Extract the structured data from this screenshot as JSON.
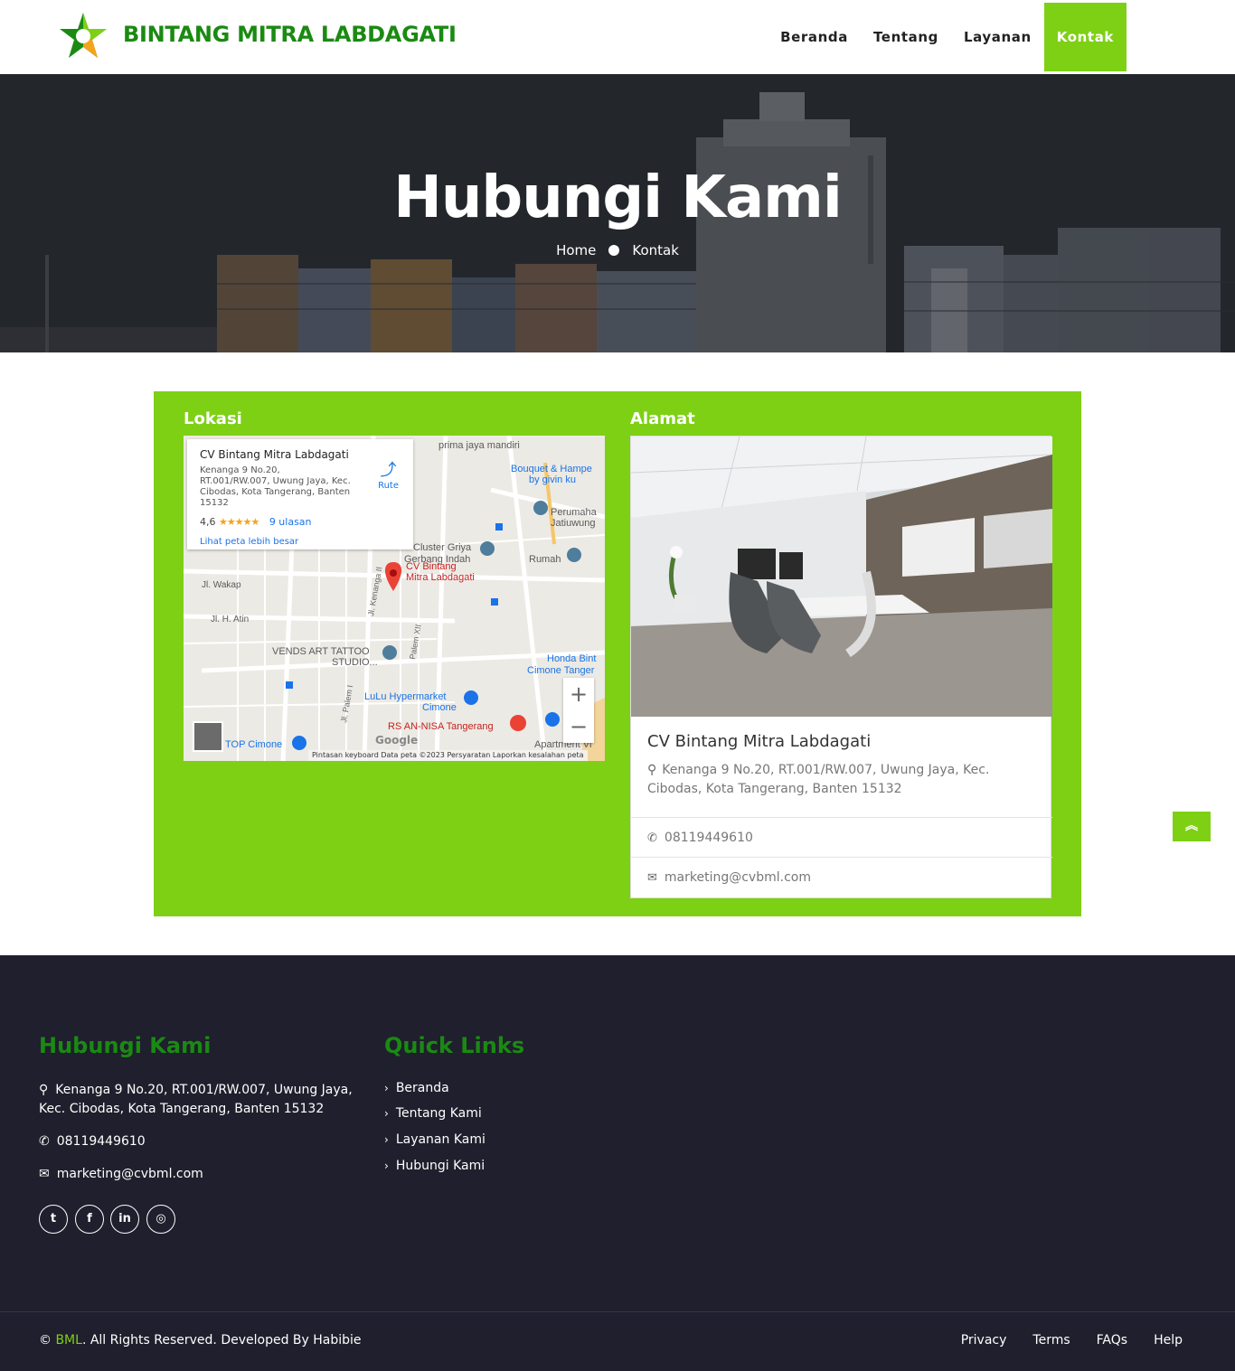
{
  "colors": {
    "brand_green": "#1a8a12",
    "accent_green": "#7ed015",
    "footer_bg": "#1f1f2d"
  },
  "header": {
    "brand": "BINTANG MITRA LABDAGATI",
    "nav": [
      "Beranda",
      "Tentang",
      "Layanan",
      "Kontak"
    ],
    "active_nav": "Kontak"
  },
  "hero": {
    "title": "Hubungi Kami",
    "breadcrumb": [
      "Home",
      "Kontak"
    ]
  },
  "contact": {
    "location_title": "Lokasi",
    "address_title": "Alamat",
    "map": {
      "place_name": "CV Bintang Mitra Labdagati",
      "place_address": "Kenanga 9 No.20, RT.001/RW.007, Uwung Jaya, Kec. Cibodas, Kota Tangerang, Banten 15132",
      "rating": "4,6",
      "stars": "★★★★★",
      "reviews": "9 ulasan",
      "larger_map": "Lihat peta lebih besar",
      "route": "Rute",
      "pin_label_1": "CV Bintang",
      "pin_label_2": "Mitra Labdagati",
      "labels": [
        "prima jaya mandiri",
        "Bouquet & Hampe",
        "by givin ku",
        "Perumaha",
        "Jatiuwung",
        "Cluster Griya",
        "Gerbang Indah",
        "Rumah",
        "Jl. Wakap",
        "Jl. H. Atin",
        "VENDS ART TATTOO",
        "STUDIO...",
        "Honda Bint",
        "Cimone Tanger",
        "LuLu Hypermarket",
        "Cimone",
        "RS AN-NISA Tangerang",
        "TOP Cimone",
        "Apartment Vi",
        "Jl. Kenanga II",
        "Palem XII",
        "Jl. Palem I"
      ],
      "google": "Google",
      "footer": "Pintasan keyboard   Data peta ©2023   Persyaratan   Laporkan kesalahan peta",
      "zoom_in": "+",
      "zoom_out": "−"
    },
    "card": {
      "name": "CV Bintang Mitra Labdagati",
      "address": "Kenanga 9 No.20, RT.001/RW.007, Uwung Jaya, Kec. Cibodas, Kota Tangerang, Banten 15132",
      "phone": "08119449610",
      "email": "marketing@cvbml.com"
    }
  },
  "footer": {
    "contact_title": "Hubungi Kami",
    "address": "Kenanga 9 No.20, RT.001/RW.007, Uwung Jaya, Kec. Cibodas, Kota Tangerang, Banten 15132",
    "phone": "08119449610",
    "email": "marketing@cvbml.com",
    "social": [
      "twitter",
      "facebook",
      "linkedin",
      "instagram"
    ],
    "links_title": "Quick Links",
    "links": [
      "Beranda",
      "Tentang Kami",
      "Layanan Kami",
      "Hubungi Kami"
    ],
    "copyright_prefix": "© ",
    "copyright_brand": "BML",
    "copyright_suffix": ". All Rights Reserved. Developed By Habibie",
    "bottom_links": [
      "Privacy",
      "Terms",
      "FAQs",
      "Help"
    ]
  }
}
